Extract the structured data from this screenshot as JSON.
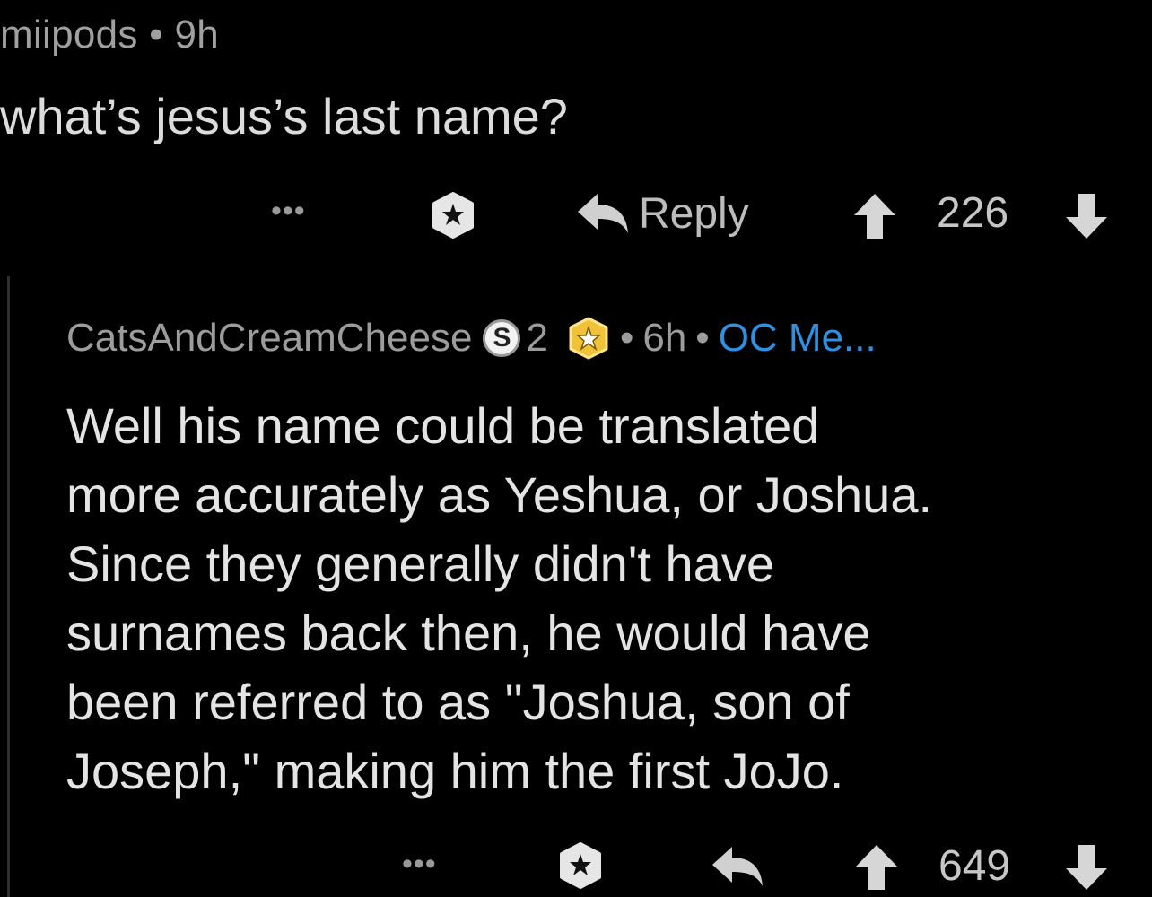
{
  "comment1": {
    "author": "miipods",
    "separator": "•",
    "age": "9h",
    "body": "what’s jesus’s last name?",
    "actions": {
      "more_label": "•••",
      "reply_label": "Reply",
      "score": "226"
    }
  },
  "comment2": {
    "author": "CatsAndCreamCheese",
    "silver_icon_letter": "S",
    "silver_count": "2",
    "separator1": "•",
    "age": "6h",
    "separator2": "•",
    "flair": "OC Me...",
    "body_lines": [
      "Well his name could be translated",
      "more accurately as Yeshua, or Joshua.",
      "Since they generally didn't have",
      "surnames back then, he would have",
      "been referred to as \"Joshua, son of",
      "Joseph,\" making him the first JoJo."
    ],
    "actions": {
      "more_label": "•••",
      "score": "649"
    }
  },
  "colors": {
    "background": "#000000",
    "flair_blue": "#2f8fe0",
    "gold_award": "#f0c23a",
    "silver_award": "#f2f2f2"
  },
  "icons": [
    "more-icon",
    "award-icon",
    "reply-icon",
    "upvote-icon",
    "downvote-icon",
    "silver-award-icon",
    "gold-award-icon"
  ]
}
